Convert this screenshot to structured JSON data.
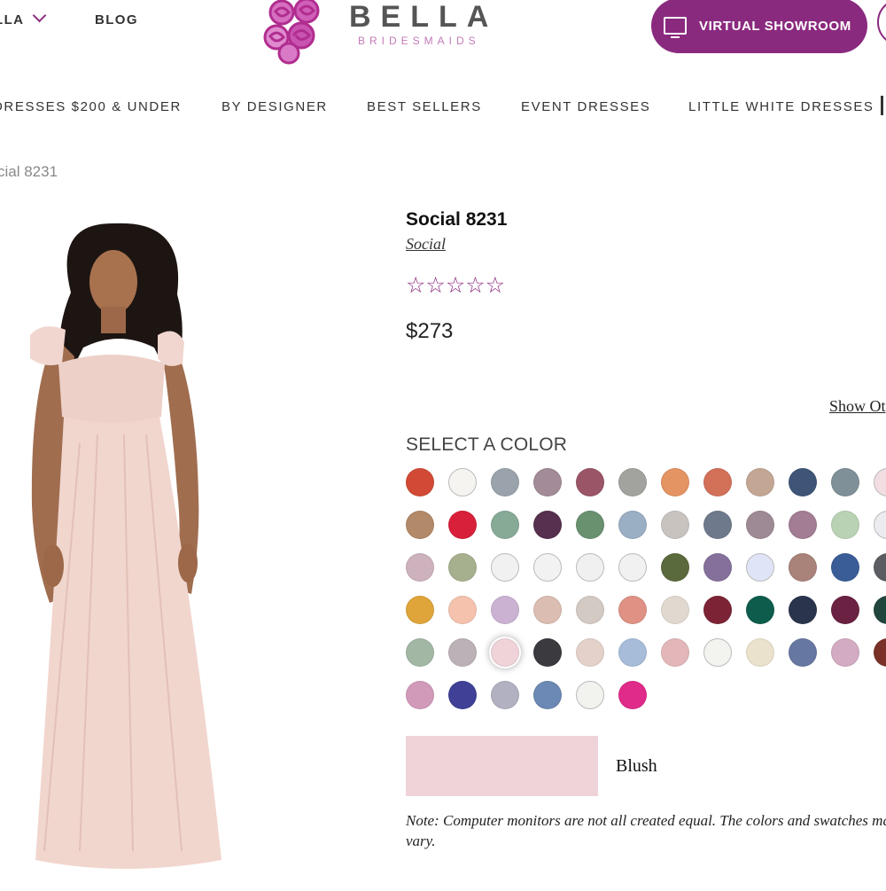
{
  "header": {
    "left_menu_label": "LLA",
    "blog_label": "BLOG",
    "logo_word": "BELLA",
    "logo_sub": "BRIDESMAIDS",
    "showroom_label": "VIRTUAL SHOWROOM"
  },
  "nav": {
    "items": [
      "DRESSES $200 & UNDER",
      "BY DESIGNER",
      "BEST SELLERS",
      "EVENT DRESSES",
      "LITTLE WHITE DRESSES"
    ]
  },
  "breadcrumb": "cial 8231",
  "product": {
    "title": "Social 8231",
    "brand": "Social",
    "rating_stars": "☆☆☆☆☆",
    "price": "$273",
    "show_other_label": "Show Ot",
    "select_color_label": "SELECT A COLOR",
    "selected_color_name": "Blush",
    "selected_color_hex": "#efd3d9",
    "note": "Note: Computer monitors are not all created equal. The colors and swatches may vary."
  },
  "swatch_rows": [
    [
      "#d24a35",
      "#f6f4f1",
      "#9aa3ab",
      "#a38b98",
      "#9a5566",
      "#a2a39f",
      "#e49462",
      "#d27058",
      "#c4a695",
      "#3e5578",
      "#7f9098",
      "#f1dde2"
    ],
    [
      "#b38a69",
      "#d8203a",
      "#86aa96",
      "#56304e",
      "#69906f",
      "#9aaec4",
      "#c9c3c0",
      "#6e7a8c",
      "#9e8a94",
      "#a27d93",
      "#b9d2b3",
      "#ecebef"
    ],
    [
      "#cdb2bd",
      "#a6b08e",
      "#f1f1f1",
      "#f2f2f2",
      "#f0f0f0",
      "#f1f1f1",
      "#5b6a3c",
      "#85709c",
      "#dfe4f6",
      "#a98279",
      "#3a5d98",
      "#5b5d62"
    ],
    [
      "#dfa53a",
      "#f5c2ae",
      "#cbb2d3",
      "#dbbdb1",
      "#d4cac4",
      "#df9184",
      "#e1d9cf",
      "#7d2336",
      "#0e5d4c",
      "#2a344c",
      "#6b2142",
      "#21463e"
    ],
    [
      "#a2b8a4",
      "#bcb1b7",
      "#efd3d9",
      "#3a3a3f",
      "#e4d2ca",
      "#a6bcd9",
      "#e3b7ba",
      "#f3f3f0",
      "#eae2cc",
      "#6677a2",
      "#d3abc2",
      "#7a3128"
    ],
    [
      "#d09ab8",
      "#3f4096",
      "#b1b1c2",
      "#6c88b4",
      "#f2f2ef",
      "#e02b8a"
    ]
  ]
}
